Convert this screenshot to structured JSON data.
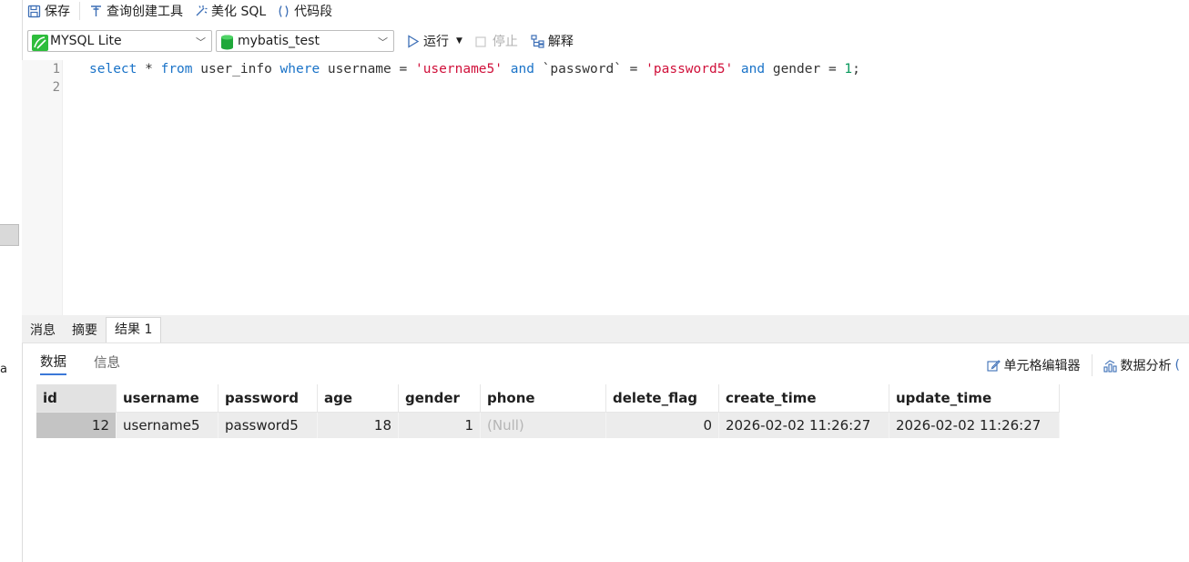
{
  "toolbar": {
    "save": "保存",
    "query_builder": "查询创建工具",
    "beautify": "美化 SQL",
    "snippet": "代码段"
  },
  "connection": {
    "selected": "MYSQL Lite"
  },
  "database": {
    "selected": "mybatis_test"
  },
  "run_toolbar": {
    "run": "运行",
    "stop": "停止",
    "explain": "解释"
  },
  "editor": {
    "line_numbers": [
      "1",
      "2"
    ],
    "sql_tokens": {
      "select": "select",
      "star": " * ",
      "from": "from",
      "table": " user_info ",
      "where": "where",
      "col1": " username = ",
      "val1": "'username5'",
      "and1": " and ",
      "col2": "`password` = ",
      "val2": "'password5'",
      "and2": " and ",
      "col3": "gender = ",
      "val3": "1",
      "end": ";"
    }
  },
  "result_tabs": [
    "消息",
    "摘要",
    "结果 1"
  ],
  "sub_tabs": [
    "数据",
    "信息"
  ],
  "actions": {
    "cell_editor": "单元格编辑器",
    "data_analysis": "数据分析"
  },
  "left_fragment": "a",
  "table": {
    "columns": [
      "id",
      "username",
      "password",
      "age",
      "gender",
      "phone",
      "delete_flag",
      "create_time",
      "update_time"
    ],
    "rows": [
      [
        "12",
        "username5",
        "password5",
        "18",
        "1",
        "(Null)",
        "0",
        "2026-02-02 11:26:27",
        "2026-02-02 11:26:27"
      ]
    ]
  }
}
